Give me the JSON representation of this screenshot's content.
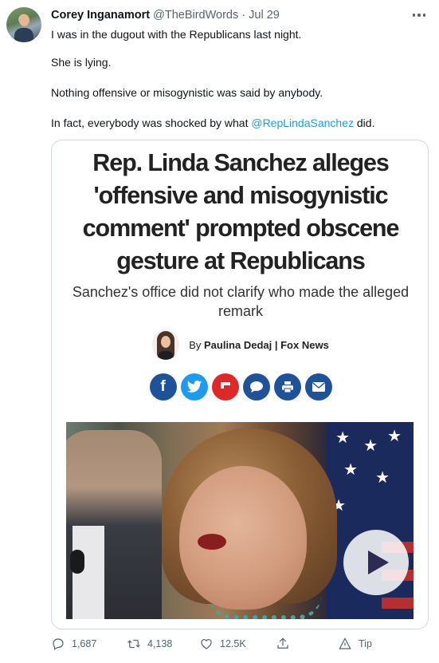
{
  "tweet": {
    "author_name": "Corey Inganamort",
    "author_handle": "@TheBirdWords",
    "separator": "·",
    "date": "Jul 29",
    "paragraphs": [
      "I was in the dugout with the Republicans last night.",
      "She is lying.",
      "Nothing offensive or misogynistic was said by anybody."
    ],
    "last_paragraph_prefix": "In fact, everybody was shocked by what ",
    "mention": "@RepLindaSanchez",
    "last_paragraph_suffix": " did."
  },
  "card": {
    "headline_lines": [
      "Rep. Linda Sanchez alleges",
      "'offensive and misogynistic",
      "comment' prompted obscene",
      "gesture at Republicans"
    ],
    "subhead_lines": [
      "Sanchez's office did not clarify who made the alleged",
      "remark"
    ],
    "byline_prefix": "By ",
    "author": "Paulina Dedaj",
    "byline_separator": " | ",
    "outlet": "Fox News",
    "share_buttons": [
      {
        "icon": "facebook-icon",
        "glyph": "f"
      },
      {
        "icon": "twitter-icon",
        "glyph": ""
      },
      {
        "icon": "flipboard-icon",
        "glyph": ""
      },
      {
        "icon": "comment-icon",
        "glyph": ""
      },
      {
        "icon": "print-icon",
        "glyph": ""
      },
      {
        "icon": "email-icon",
        "glyph": ""
      }
    ],
    "colors": {
      "share_blue": "#1f5399",
      "twitter_blue": "#1d9bf0",
      "flipboard_red": "#e12828"
    }
  },
  "actions": {
    "replies": "1,687",
    "retweets": "4,138",
    "likes": "12.5K",
    "tip": "Tip"
  },
  "colors": {
    "link": "#1d9bf0",
    "secondary_text": "#536471",
    "border": "#cfd9de"
  }
}
